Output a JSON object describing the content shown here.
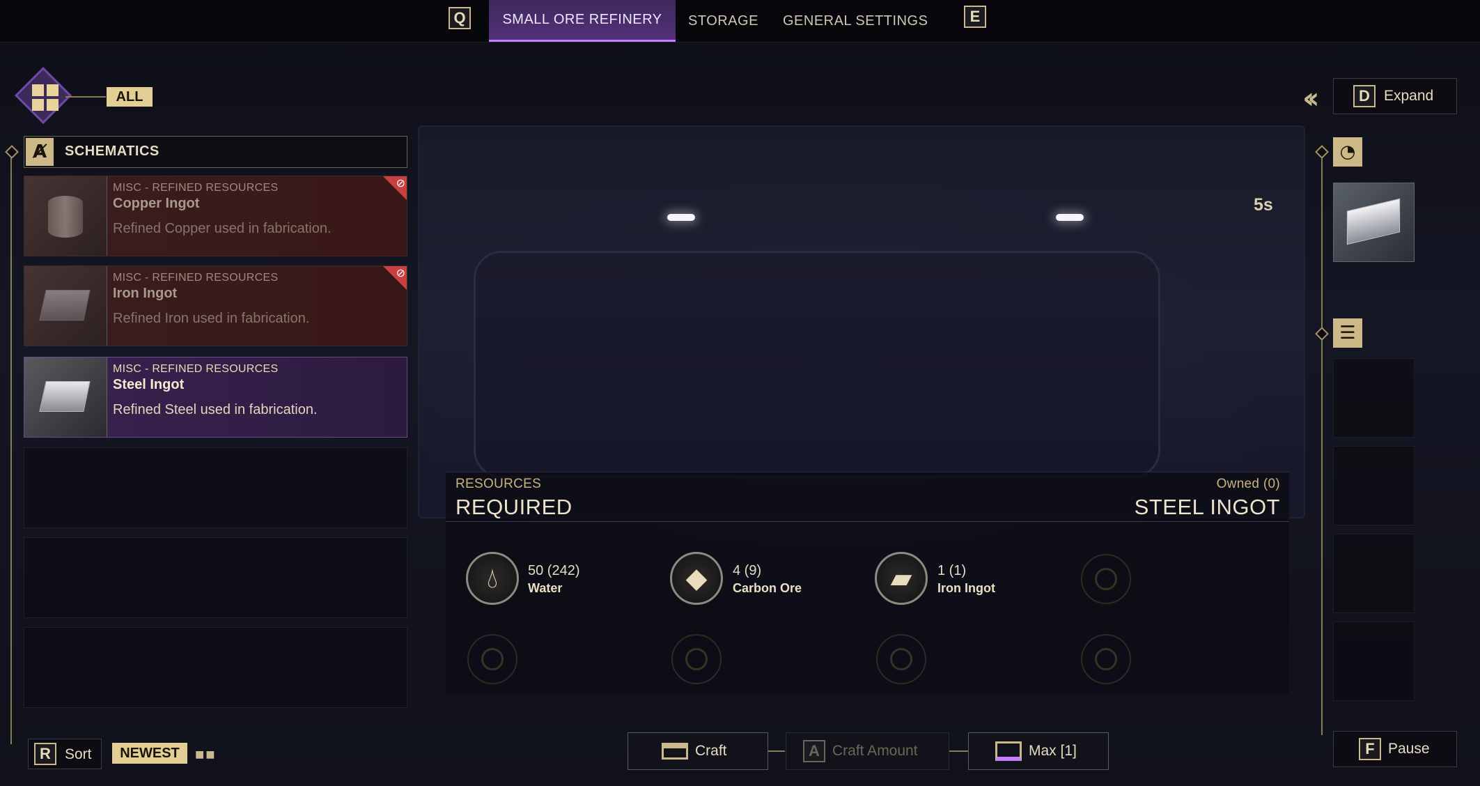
{
  "topbar": {
    "left_key": "Q",
    "right_key": "E",
    "tabs": [
      {
        "label": "SMALL ORE REFINERY",
        "active": true
      },
      {
        "label": "STORAGE",
        "active": false
      },
      {
        "label": "GENERAL SETTINGS",
        "active": false
      }
    ]
  },
  "filter": {
    "label": "ALL"
  },
  "schematics": {
    "header": "SCHEMATICS",
    "header_icon": "compass-icon",
    "items": [
      {
        "category": "MISC - REFINED RESOURCES",
        "name": "Copper Ingot",
        "description": "Refined Copper used in fabrication.",
        "locked": true
      },
      {
        "category": "MISC - REFINED RESOURCES",
        "name": "Iron Ingot",
        "description": "Refined Iron used in fabrication.",
        "locked": true
      },
      {
        "category": "MISC - REFINED RESOURCES",
        "name": "Steel Ingot",
        "description": "Refined Steel used in fabrication.",
        "locked": false,
        "selected": true
      }
    ]
  },
  "sort": {
    "key": "R",
    "label": "Sort",
    "mode": "NEWEST"
  },
  "resources": {
    "small_label": "RESOURCES",
    "big_label": "REQUIRED",
    "owned_label": "Owned (0)",
    "item_title": "STEEL INGOT",
    "items": [
      {
        "count": "50 (242)",
        "name": "Water",
        "icon": "water-drop-icon"
      },
      {
        "count": "4 (9)",
        "name": "Carbon Ore",
        "icon": "ore-icon"
      },
      {
        "count": "1 (1)",
        "name": "Iron Ingot",
        "icon": "ingot-icon"
      }
    ]
  },
  "actions": {
    "craft_label": "Craft",
    "amount_key": "A",
    "amount_label": "Craft Amount",
    "max_label": "Max [1]"
  },
  "right": {
    "expand_key": "D",
    "expand_label": "Expand",
    "timer": "5s",
    "pause_key": "F",
    "pause_label": "Pause"
  },
  "colors": {
    "accent": "#c77dff",
    "gold": "#e3cf93",
    "locked": "#c84040"
  }
}
